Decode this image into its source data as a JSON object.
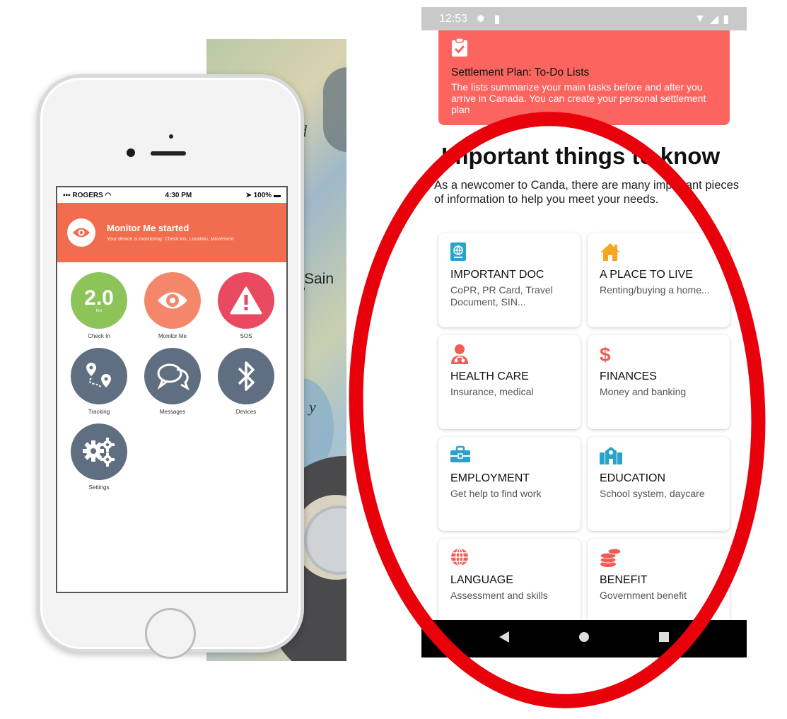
{
  "left_phone": {
    "status": {
      "carrier": "ROGERS",
      "time": "4:30 PM",
      "battery": "100%"
    },
    "banner": {
      "title": "Monitor Me started",
      "subtitle": "Your device is monitoring: Check ins, Location, Movement"
    },
    "tiles": [
      {
        "label": "Check In",
        "value": "2.0",
        "unit": "hrs",
        "color": "#8cc45a"
      },
      {
        "label": "Monitor Me",
        "color": "#f4876a"
      },
      {
        "label": "SOS",
        "color": "#ea4a60"
      },
      {
        "label": "Tracking",
        "color": "#5f6e80"
      },
      {
        "label": "Messages",
        "color": "#5f6e80"
      },
      {
        "label": "Devices",
        "color": "#5f6e80"
      },
      {
        "label": "Settings",
        "color": "#5f6e80"
      }
    ],
    "map": {
      "text_1": "nd",
      "text_2": "y",
      "city": "Sain"
    }
  },
  "android_app": {
    "status_bar": {
      "time": "12:53"
    },
    "settlement_card": {
      "title": "Settlement Plan: To-Do Lists",
      "description": "The lists summarize your main tasks before and after you arrive in Canada. You can create your personal settlement plan",
      "color": "#fc645f"
    },
    "heading": "Important things to know",
    "intro": "As a newcomer to Canda, there are many important pieces of information to help you meet your needs.",
    "categories": [
      {
        "title": "IMPORTANT DOC",
        "subtitle": "CoPR, PR Card, Travel Document, SIN...",
        "icon": "passport-icon",
        "color": "#29a3c7"
      },
      {
        "title": "A PLACE TO LIVE",
        "subtitle": "Renting/buying a home...",
        "icon": "house-icon",
        "color": "#f5a623"
      },
      {
        "title": "HEALTH CARE",
        "subtitle": "Insurance, medical",
        "icon": "doctor-icon",
        "color": "#f25c54"
      },
      {
        "title": "FINANCES",
        "subtitle": "Money and banking",
        "icon": "dollar-icon",
        "color": "#f25c54"
      },
      {
        "title": "EMPLOYMENT",
        "subtitle": "Get help to find work",
        "icon": "briefcase-icon",
        "color": "#29a3c7"
      },
      {
        "title": "EDUCATION",
        "subtitle": "School system, daycare",
        "icon": "school-icon",
        "color": "#29a3c7"
      },
      {
        "title": "LANGUAGE",
        "subtitle": "Assessment and skills",
        "icon": "globe-icon",
        "color": "#f25c54"
      },
      {
        "title": "BENEFIT",
        "subtitle": "Government benefit",
        "icon": "coins-icon",
        "color": "#f25c54"
      }
    ],
    "nav": [
      "back-icon",
      "home-icon",
      "recents-icon"
    ]
  },
  "annotation_color": "#e8000b"
}
